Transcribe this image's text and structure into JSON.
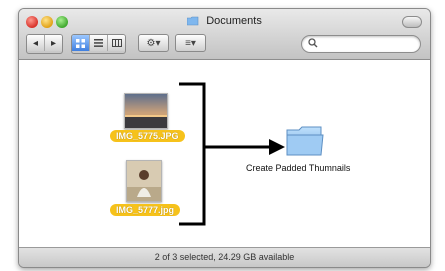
{
  "window": {
    "title": "Documents",
    "status": "2 of 3 selected, 24.29 GB available"
  },
  "toolbar": {
    "back_forward": "◂ ▸",
    "view_modes": [
      "icon",
      "list",
      "column"
    ],
    "action_menu": "⚙▾",
    "arrange_menu": "≡▾",
    "search_placeholder": ""
  },
  "files": [
    {
      "name": "IMG_5775.JPG",
      "selected": true
    },
    {
      "name": "IMG_5777.jpg",
      "selected": true
    }
  ],
  "target_folder": {
    "name": "Create Padded Thumnails"
  },
  "colors": {
    "selection_label": "#f6c21b",
    "folder": "#8fc3f3",
    "window_chrome": "#dcdcdc"
  }
}
